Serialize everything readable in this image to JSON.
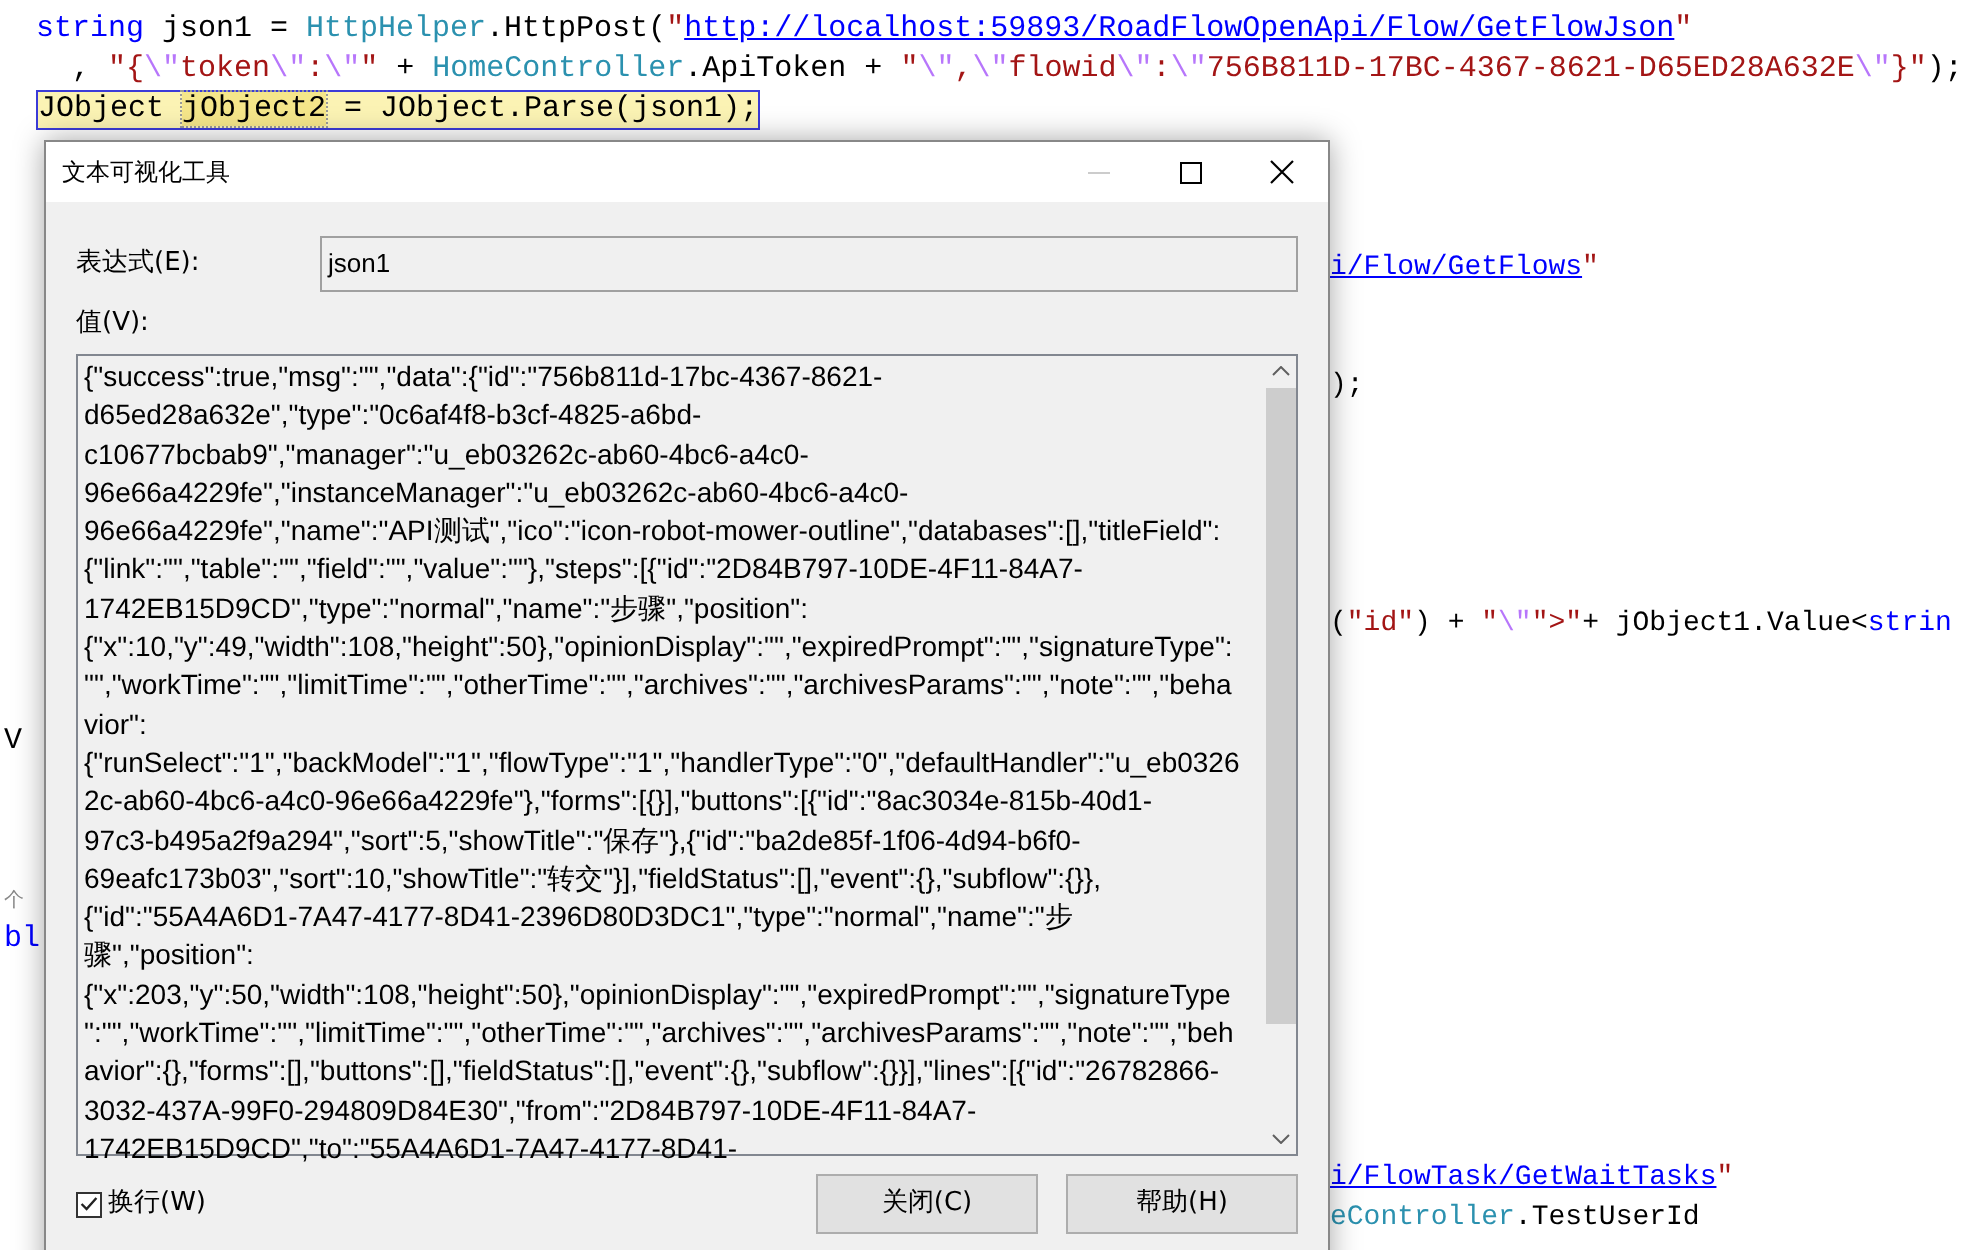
{
  "editor": {
    "lines": [
      {
        "kind": "full",
        "current": false,
        "tokens": [
          {
            "kind": "keyword",
            "text": "string"
          },
          {
            "kind": "plain",
            "text": " json1 = "
          },
          {
            "kind": "type",
            "text": "HttpHelper"
          },
          {
            "kind": "plain",
            "text": ".HttpPost("
          },
          {
            "kind": "string",
            "text": "\""
          },
          {
            "kind": "link",
            "text": "http://localhost:59893/RoadFlowOpenApi/Flow/GetFlowJson"
          },
          {
            "kind": "string",
            "text": "\""
          }
        ]
      },
      {
        "kind": "full",
        "current": false,
        "tokens": [
          {
            "kind": "plain",
            "text": "  , "
          },
          {
            "kind": "string",
            "text": "\"{"
          },
          {
            "kind": "escape",
            "text": "\\\""
          },
          {
            "kind": "string",
            "text": "token"
          },
          {
            "kind": "escape",
            "text": "\\\""
          },
          {
            "kind": "string",
            "text": ":"
          },
          {
            "kind": "escape",
            "text": "\\\""
          },
          {
            "kind": "string",
            "text": "\""
          },
          {
            "kind": "plain",
            "text": " + "
          },
          {
            "kind": "type",
            "text": "HomeController"
          },
          {
            "kind": "plain",
            "text": ".ApiToken + "
          },
          {
            "kind": "string",
            "text": "\""
          },
          {
            "kind": "escape",
            "text": "\\\""
          },
          {
            "kind": "string",
            "text": ","
          },
          {
            "kind": "escape",
            "text": "\\\""
          },
          {
            "kind": "string",
            "text": "flowid"
          },
          {
            "kind": "escape",
            "text": "\\\""
          },
          {
            "kind": "string",
            "text": ":"
          },
          {
            "kind": "escape",
            "text": "\\\""
          },
          {
            "kind": "string",
            "text": "756B811D-17BC-4367-8621-D65ED28A632E"
          },
          {
            "kind": "escape",
            "text": "\\\""
          },
          {
            "kind": "string",
            "text": "}\""
          },
          {
            "kind": "plain",
            "text": ");"
          }
        ]
      },
      {
        "kind": "full",
        "current": true,
        "tokens": [
          {
            "kind": "plain",
            "text": "JObject "
          },
          {
            "kind": "symbol",
            "text": "jObject2"
          },
          {
            "kind": "plain",
            "text": " = JObject.Parse(json1);"
          }
        ]
      },
      {
        "kind": "blank"
      },
      {
        "kind": "blank"
      },
      {
        "kind": "blank"
      },
      {
        "kind": "right",
        "current": false,
        "tokens": [
          {
            "kind": "link",
            "text": "i/Flow/GetFlows"
          },
          {
            "kind": "string",
            "text": "\""
          }
        ]
      },
      {
        "kind": "blank"
      },
      {
        "kind": "blank"
      },
      {
        "kind": "right",
        "current": false,
        "tokens": [
          {
            "kind": "plain",
            "text": ");"
          }
        ]
      },
      {
        "kind": "blank"
      },
      {
        "kind": "blank"
      },
      {
        "kind": "blank"
      },
      {
        "kind": "blank"
      },
      {
        "kind": "blank"
      },
      {
        "kind": "right",
        "current": false,
        "tokens": [
          {
            "kind": "plain",
            "text": "("
          },
          {
            "kind": "string",
            "text": "\"id\""
          },
          {
            "kind": "plain",
            "text": ") + "
          },
          {
            "kind": "string",
            "text": "\""
          },
          {
            "kind": "escape",
            "text": "\\\""
          },
          {
            "kind": "string",
            "text": "\">\""
          },
          {
            "kind": "plain",
            "text": "+ jObject1.Value<"
          },
          {
            "kind": "keyword",
            "text": "strin"
          }
        ]
      },
      {
        "kind": "blank"
      },
      {
        "kind": "blank"
      },
      {
        "kind": "left",
        "current": false,
        "tokens": [
          {
            "kind": "plain",
            "text": "V"
          }
        ]
      },
      {
        "kind": "blank"
      },
      {
        "kind": "blank"
      },
      {
        "kind": "blank"
      },
      {
        "kind": "left",
        "current": false,
        "tokens": [
          {
            "kind": "note",
            "text": "个"
          }
        ]
      },
      {
        "kind": "left",
        "current": false,
        "tokens": [
          {
            "kind": "keyword",
            "text": "bl"
          }
        ]
      },
      {
        "kind": "blank"
      },
      {
        "kind": "blank"
      },
      {
        "kind": "blank"
      },
      {
        "kind": "blank"
      },
      {
        "kind": "blank"
      },
      {
        "kind": "right",
        "current": false,
        "tokens": [
          {
            "kind": "link",
            "text": "i/FlowTask/GetWaitTasks"
          },
          {
            "kind": "string",
            "text": "\""
          }
        ]
      },
      {
        "kind": "right",
        "current": false,
        "tokens": [
          {
            "kind": "type",
            "text": "eController"
          },
          {
            "kind": "plain",
            "text": ".TestUserId"
          }
        ]
      }
    ]
  },
  "dialog": {
    "title": "文本可视化工具",
    "minimize_disabled": true,
    "expression": {
      "label": "表达式(E):",
      "value": "json1"
    },
    "value": {
      "label": "值(V):",
      "lines": [
        "{\"success\":true,\"msg\":\"\",\"data\":{\"id\":\"756b811d-17bc-4367-8621-",
        "d65ed28a632e\",\"type\":\"0c6af4f8-b3cf-4825-a6bd-",
        "c10677bcbab9\",\"manager\":\"u_eb03262c-ab60-4bc6-a4c0-",
        "96e66a4229fe\",\"instanceManager\":\"u_eb03262c-ab60-4bc6-a4c0-",
        "96e66a4229fe\",\"name\":\"API测试\",\"ico\":\"icon-robot-mower-outline\",\"databases\":[],\"titleField\":",
        "{\"link\":\"\",\"table\":\"\",\"field\":\"\",\"value\":\"\"},\"steps\":[{\"id\":\"2D84B797-10DE-4F11-84A7-",
        "1742EB15D9CD\",\"type\":\"normal\",\"name\":\"步骤\",\"position\":",
        "{\"x\":10,\"y\":49,\"width\":108,\"height\":50},\"opinionDisplay\":\"\",\"expiredPrompt\":\"\",\"signatureType\":",
        "\"\",\"workTime\":\"\",\"limitTime\":\"\",\"otherTime\":\"\",\"archives\":\"\",\"archivesParams\":\"\",\"note\":\"\",\"beha",
        "vior\":",
        "{\"runSelect\":\"1\",\"backModel\":\"1\",\"flowType\":\"1\",\"handlerType\":\"0\",\"defaultHandler\":\"u_eb0326",
        "2c-ab60-4bc6-a4c0-96e66a4229fe\"},\"forms\":[{}],\"buttons\":[{\"id\":\"8ac3034e-815b-40d1-",
        "97c3-b495a2f9a294\",\"sort\":5,\"showTitle\":\"保存\"},{\"id\":\"ba2de85f-1f06-4d94-b6f0-",
        "69eafc173b03\",\"sort\":10,\"showTitle\":\"转交\"}],\"fieldStatus\":[],\"event\":{},\"subflow\":{}},",
        "{\"id\":\"55A4A6D1-7A47-4177-8D41-2396D80D3DC1\",\"type\":\"normal\",\"name\":\"步",
        "骤\",\"position\":",
        "{\"x\":203,\"y\":50,\"width\":108,\"height\":50},\"opinionDisplay\":\"\",\"expiredPrompt\":\"\",\"signatureType",
        "\":\"\",\"workTime\":\"\",\"limitTime\":\"\",\"otherTime\":\"\",\"archives\":\"\",\"archivesParams\":\"\",\"note\":\"\",\"beh",
        "avior\":{},\"forms\":[],\"buttons\":[],\"fieldStatus\":[],\"event\":{},\"subflow\":{}}],\"lines\":[{\"id\":\"26782866-",
        "3032-437A-99F0-294809D84E30\",\"from\":\"2D84B797-10DE-4F11-84A7-",
        "1742EB15D9CD\",\"to\":\"55A4A6D1-7A47-4177-8D41-"
      ]
    },
    "wrap": {
      "label": "换行(W)",
      "checked": true
    },
    "buttons": [
      "关闭(C)",
      "帮助(H)"
    ]
  }
}
